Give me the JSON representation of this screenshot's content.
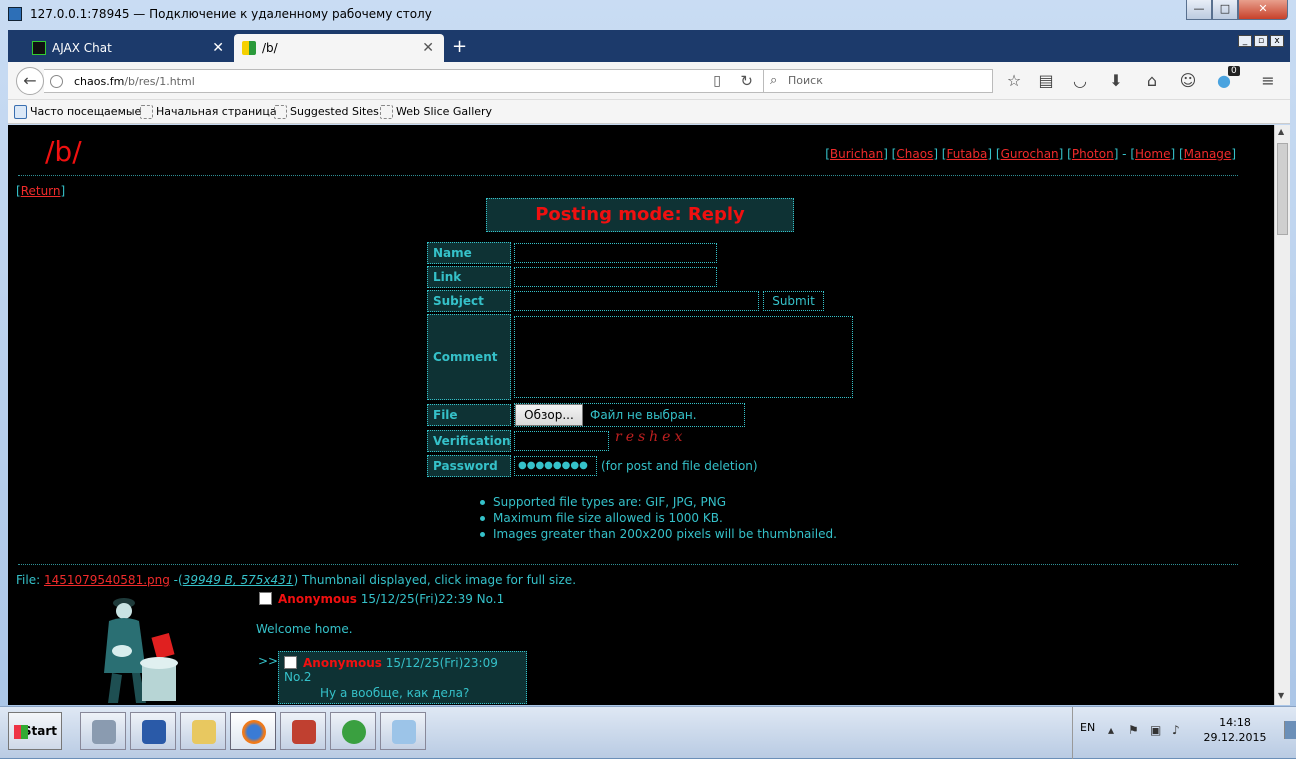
{
  "window": {
    "title": "127.0.0.1:78945 — Подключение к удаленному рабочему столу",
    "min": "—",
    "max": "□",
    "close": "✕"
  },
  "tabs": [
    {
      "label": "AJAX Chat",
      "close": "✕"
    },
    {
      "label": "/b/",
      "close": "✕"
    }
  ],
  "newtab": "+",
  "nav": {
    "back": "←",
    "url_host": "chaos.fm",
    "url_path": "/b/res/1.html",
    "reload": "↻",
    "reader": "▯",
    "search_placeholder": "Поиск",
    "notif_count": "0"
  },
  "bookmarks": [
    "Часто посещаемые",
    "Начальная страница",
    "Suggested Sites",
    "Web Slice Gallery"
  ],
  "board": {
    "title": "/b/",
    "links": [
      "Burichan",
      "Chaos",
      "Futaba",
      "Gurochan",
      "Photon",
      "Home",
      "Manage"
    ],
    "return": "Return",
    "mode": "Posting mode: Reply"
  },
  "form": {
    "name": "Name",
    "link": "Link",
    "subject": "Subject",
    "submit": "Submit",
    "comment": "Comment",
    "file": "File",
    "browse": "Обзор...",
    "no_file": "Файл не выбран.",
    "verification": "Verification",
    "captcha": "reshex",
    "password": "Password",
    "password_value": "●●●●●●●●",
    "password_note": "(for post and file deletion)"
  },
  "rules": [
    "Supported file types are: GIF, JPG, PNG",
    "Maximum file size allowed is 1000 KB.",
    "Images greater than 200x200 pixels will be thumbnailed."
  ],
  "post": {
    "file_label": "File:",
    "file_name": "1451079540581.png",
    "file_meta": "39949 B, 575x431",
    "file_note": "Thumbnail displayed, click image for full size.",
    "author": "Anonymous",
    "date": "15/12/25(Fri)22:39",
    "no": "No.1",
    "message": "Welcome home.",
    "reply_arrow": ">>",
    "reply_author": "Anonymous",
    "reply_date": "15/12/25(Fri)23:09",
    "reply_no": "No.2",
    "reply_message": "Ну а вообще, как дела?"
  },
  "taskbar": {
    "start": "Start",
    "lang": "EN",
    "time": "14:18",
    "date": "29.12.2015"
  }
}
